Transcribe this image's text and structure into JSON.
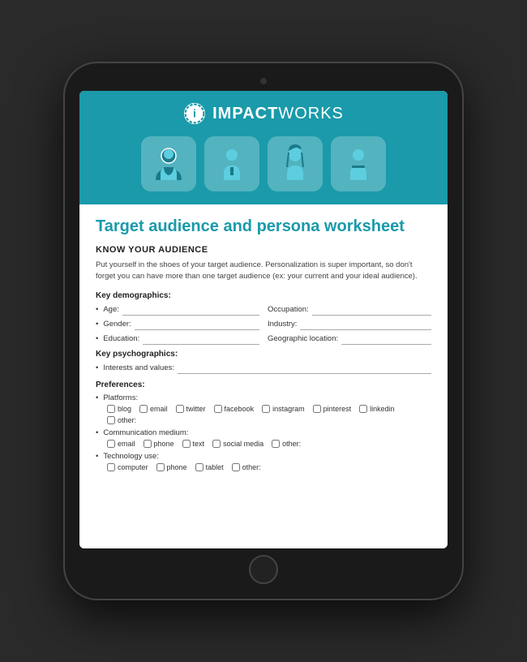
{
  "tablet": {
    "background": "#1a1a1a"
  },
  "header": {
    "logo_bold": "IMPACT",
    "logo_regular": "WORKS",
    "background": "#1a9aaa"
  },
  "content": {
    "title": "Target audience and persona worksheet",
    "section_heading": "KNOW YOUR AUDIENCE",
    "intro": "Put yourself in the shoes of your target audience. Personalization is super important, so don't forget you can have more than one target audience (ex: your current and your ideal audience).",
    "demographics_label": "Key demographics:",
    "psychographics_label": "Key psychographics:",
    "preferences_label": "Preferences:",
    "fields": {
      "age_label": "Age:",
      "occupation_label": "Occupation:",
      "gender_label": "Gender:",
      "industry_label": "Industry:",
      "education_label": "Education:",
      "geographic_label": "Geographic location:",
      "interests_label": "Interests and values:"
    },
    "platforms": {
      "label": "Platforms:",
      "items": [
        "blog",
        "email",
        "twitter",
        "facebook",
        "instagram",
        "pinterest",
        "linkedin",
        "other:"
      ]
    },
    "communication": {
      "label": "Communication medium:",
      "items": [
        "email",
        "phone",
        "text",
        "social media",
        "other:"
      ]
    },
    "technology": {
      "label": "Technology use:",
      "items": [
        "computer",
        "phone",
        "tablet",
        "other:"
      ]
    }
  }
}
